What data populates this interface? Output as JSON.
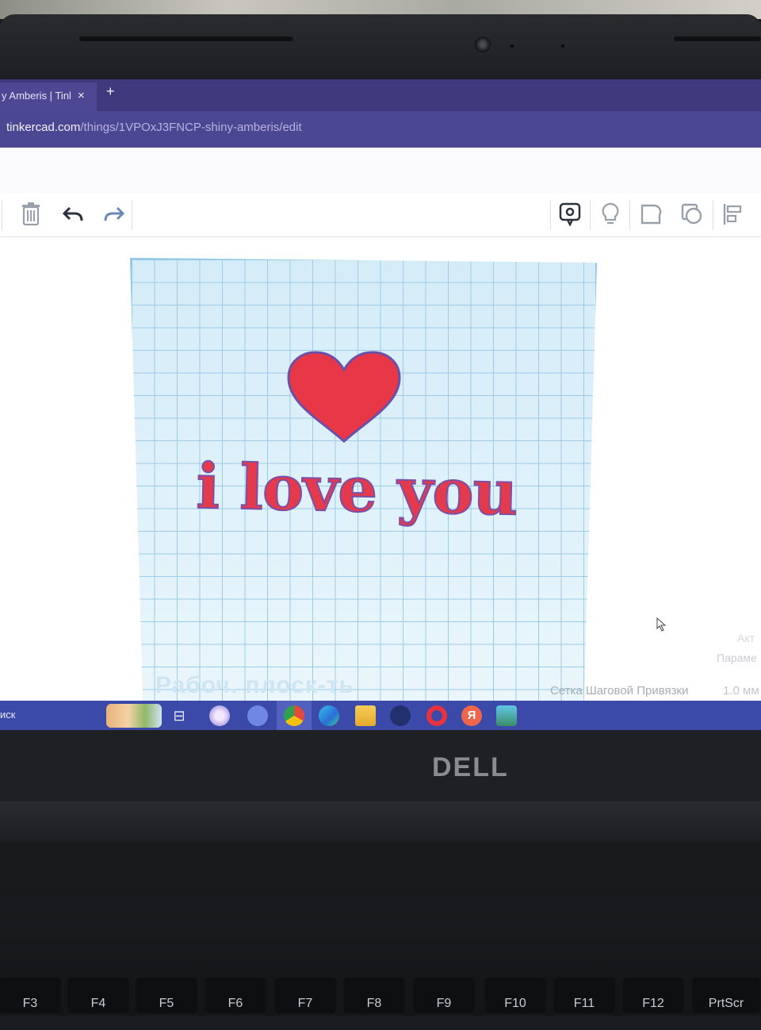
{
  "browser": {
    "tab_title": "y Amberis | Tinl",
    "tab_close": "×",
    "new_tab": "+",
    "url_host": "tinkercad.com",
    "url_path": "/things/1VPOxJ3FNCP-shiny-amberis/edit"
  },
  "toolbar": {
    "icons": [
      "trash-icon",
      "undo-icon",
      "redo-icon",
      "notes-icon",
      "lightbulb-icon",
      "group-icon",
      "ungroup-icon",
      "align-icon"
    ]
  },
  "canvas": {
    "main_text": "i love you",
    "heart_color": "#e83746",
    "text_color": "#e33a4d",
    "workplane_label": "Рабоч. плоск-ть",
    "snap_grid_label": "Сетка Шаговой Привязки",
    "snap_grid_value": "1.0 мм",
    "params_label": "Параме",
    "activate_label": "Акт"
  },
  "taskbar": {
    "search_label": "иск",
    "apps": [
      "widgets-icon",
      "task-view-icon",
      "app-icon",
      "discord-icon",
      "chrome-icon",
      "edge-icon",
      "explorer-icon",
      "steam-icon",
      "opera-icon",
      "yandex-icon",
      "app-icon-2"
    ]
  },
  "laptop": {
    "brand": "DELL",
    "keys": [
      "F3",
      "F4",
      "F5",
      "F6",
      "F7",
      "F8",
      "F9",
      "F10",
      "F11",
      "F12",
      "PrtScr"
    ]
  }
}
